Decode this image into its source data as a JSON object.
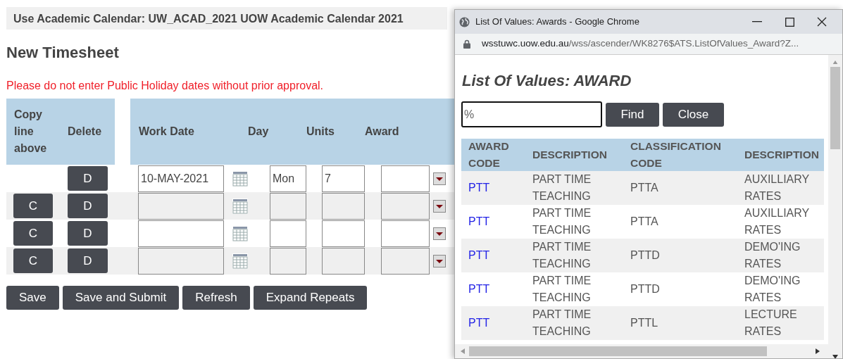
{
  "banner": "Use Academic Calendar: UW_ACAD_2021 UOW Academic Calendar 2021",
  "heading": "New Timesheet",
  "warning": "Please do not enter Public Holiday dates without prior approval.",
  "timesheet": {
    "columns": [
      "Copy line above",
      "Delete",
      "Work Date",
      "Day",
      "Units",
      "Award"
    ],
    "rows": [
      {
        "delete": "D",
        "work_date": "10-MAY-2021",
        "day": "Mon",
        "units": "7"
      },
      {
        "copy": "C",
        "delete": "D"
      },
      {
        "copy": "C",
        "delete": "D"
      },
      {
        "copy": "C",
        "delete": "D"
      }
    ]
  },
  "buttons": [
    "Save",
    "Save and Submit",
    "Refresh",
    "Expand Repeats"
  ],
  "popup": {
    "title": "List Of Values: Awards - Google Chrome",
    "url_host": "wsstuwc.uow.edu.au",
    "url_path": "/wss/ascender/WK8276$ATS.ListOfValues_Award?Z...",
    "heading": "List Of Values: AWARD",
    "search_value": "%",
    "buttons": [
      "Find",
      "Close"
    ],
    "columns": [
      "AWARD CODE",
      "DESCRIPTION",
      "CLASSIFICATION CODE",
      "DESCRIPTION"
    ],
    "rows": [
      [
        "PTT",
        "PART TIME TEACHING",
        "PTTA",
        "AUXILLIARY RATES"
      ],
      [
        "PTT",
        "PART TIME TEACHING",
        "PTTA",
        "AUXILLIARY RATES"
      ],
      [
        "PTT",
        "PART TIME TEACHING",
        "PTTD",
        "DEMO'ING RATES"
      ],
      [
        "PTT",
        "PART TIME TEACHING",
        "PTTD",
        "DEMO'ING RATES"
      ],
      [
        "PTT",
        "PART TIME TEACHING",
        "PTTL",
        "LECTURE RATES"
      ]
    ]
  }
}
